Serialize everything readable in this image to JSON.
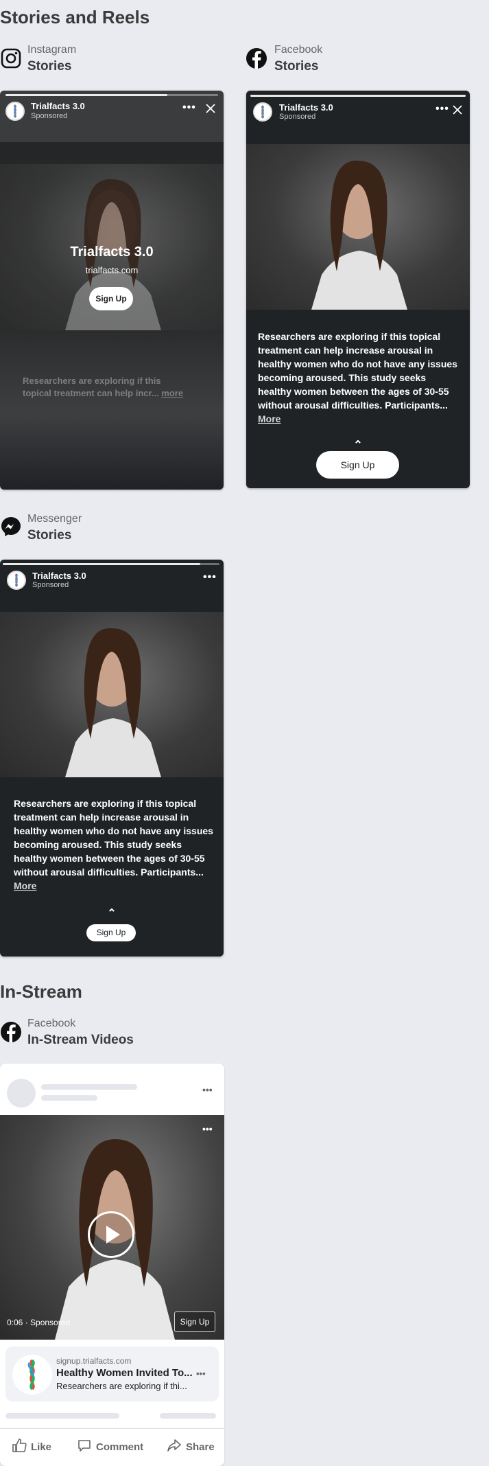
{
  "sections": {
    "stories_reels": "Stories and Reels",
    "instream": "In-Stream"
  },
  "placements": {
    "ig": {
      "platform": "Instagram",
      "placement": "Stories"
    },
    "fb": {
      "platform": "Facebook",
      "placement": "Stories"
    },
    "ms": {
      "platform": "Messenger",
      "placement": "Stories"
    },
    "fbv": {
      "platform": "Facebook",
      "placement": "In-Stream Videos"
    }
  },
  "ad": {
    "brand": "Trialfacts 3.0",
    "brand_alt": "Trialfacts 3.0",
    "sponsored": "Sponsored",
    "domain": "trialfacts.com",
    "cta": "Sign Up",
    "text_short": "Researchers are exploring if this topical treatment can help incr...",
    "more_short": "more",
    "text_full": "Researchers are exploring if this topical treatment can help increase arousal in healthy women who do not have any issues becoming aroused. This study seeks healthy women between the ages of 30-55 without arousal difficulties. Participants...",
    "more_full": "More"
  },
  "instream": {
    "time": "0:06",
    "sponsored": "Sponsored",
    "url": "signup.trialfacts.com",
    "headline": "Healthy Women Invited To...",
    "desc": "Researchers are exploring if thi...",
    "cta": "Sign Up",
    "actions": {
      "like": "Like",
      "comment": "Comment",
      "share": "Share"
    }
  },
  "colors": {
    "page_bg": "#e9ebf0",
    "story_bg": "#1f2326"
  },
  "icons": [
    "instagram-icon",
    "facebook-icon",
    "messenger-icon",
    "more-icon",
    "close-icon",
    "play-icon",
    "like-icon",
    "comment-icon",
    "share-icon",
    "chevron-up-icon"
  ],
  "progress": {
    "ig": 0.76,
    "fb": 1.0,
    "ms": 0.91
  }
}
